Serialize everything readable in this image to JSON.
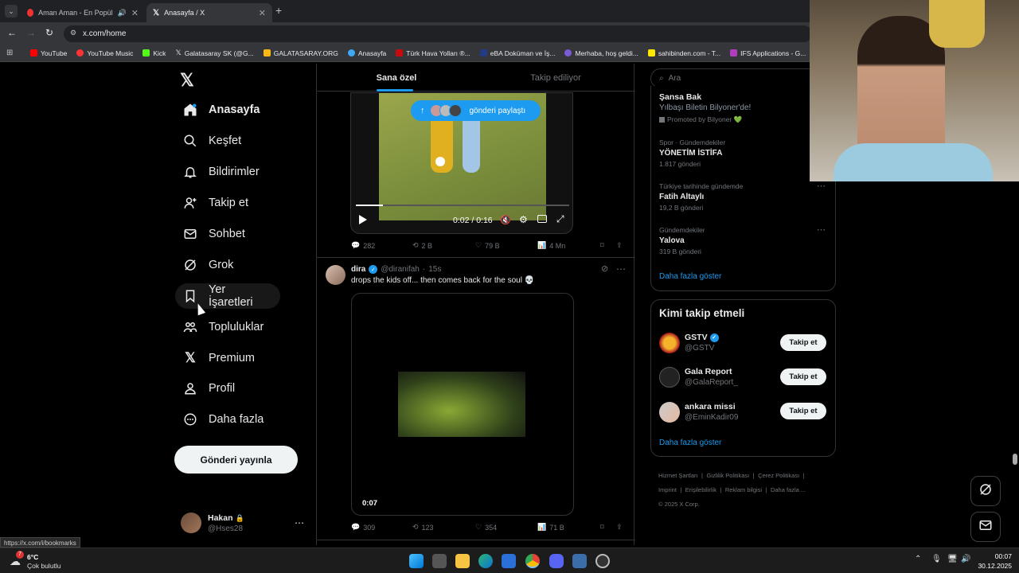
{
  "browser": {
    "tabs": [
      {
        "title": "Aman Aman - En Popüler T..."
      },
      {
        "title": "Anasayfa / X"
      }
    ],
    "url": "x.com/home",
    "bookmarks": [
      "YouTube",
      "YouTube Music",
      "Kick",
      "Galatasaray SK (@G...",
      "GALATASARAY.ORG",
      "Anasayfa",
      "Türk Hava Yolları ®...",
      "eBA Doküman ve İş...",
      "Merhaba, hoş geldi...",
      "sahibinden.com - T...",
      "IFS Applications - G..."
    ],
    "status_url": "https://x.com/i/bookmarks"
  },
  "nav": {
    "items": [
      {
        "label": "Anasayfa",
        "icon": "home-icon"
      },
      {
        "label": "Keşfet",
        "icon": "search-icon"
      },
      {
        "label": "Bildirimler",
        "icon": "bell-icon"
      },
      {
        "label": "Takip et",
        "icon": "person-plus-icon"
      },
      {
        "label": "Sohbet",
        "icon": "envelope-icon"
      },
      {
        "label": "Grok",
        "icon": "grok-icon"
      },
      {
        "label": "Yer İşaretleri",
        "icon": "bookmark-icon"
      },
      {
        "label": "Topluluklar",
        "icon": "people-icon"
      },
      {
        "label": "Premium",
        "icon": "x-logo-icon"
      },
      {
        "label": "Profil",
        "icon": "person-icon"
      },
      {
        "label": "Daha fazla",
        "icon": "more-circle-icon"
      }
    ],
    "post_button": "Gönderi yayınla",
    "account": {
      "name": "Hakan",
      "handle": "@Hses28"
    }
  },
  "feed": {
    "tabs": [
      "Sana özel",
      "Takip ediliyor"
    ],
    "new_posts_pill": "gönderi paylaştı",
    "post1": {
      "video_time": "0:02 / 0:16",
      "replies": "282",
      "reposts": "2 B",
      "likes": "79 B",
      "views": "4 Mn"
    },
    "post2": {
      "name": "dira",
      "handle": "@diranifah",
      "time": "15s",
      "text": "drops the kids off... then comes back for the soul 💀",
      "video_time": "0:07",
      "replies": "309",
      "reposts": "123",
      "likes": "354",
      "views": "71 B"
    }
  },
  "sidebar": {
    "search_placeholder": "Ara",
    "promo": {
      "title": "Şansa Bak",
      "subtitle": "Yılbaşı Biletin Bilyoner'de!",
      "promoted": "Promoted by Bilyoner 💚"
    },
    "trends": [
      {
        "category": "Spor · Gündemdekiler",
        "title": "YÖNETİM İSTİFA",
        "count": "1.817 gönderi"
      },
      {
        "category": "Türkiye tarihinde gündemde",
        "title": "Fatih Altaylı",
        "count": "19,2 B gönderi"
      },
      {
        "category": "Gündemdekiler",
        "title": "Yalova",
        "count": "319 B gönderi"
      }
    ],
    "show_more": "Daha fazla göster",
    "who_to_follow": {
      "title": "Kimi takip etmeli",
      "accounts": [
        {
          "name": "GSTV",
          "handle": "@GSTV",
          "button": "Takip et"
        },
        {
          "name": "Gala Report",
          "handle": "@GalaReport_",
          "button": "Takip et"
        },
        {
          "name": "ankara missi",
          "handle": "@EminKadir09",
          "button": "Takip et"
        }
      ],
      "show_more": "Daha fazla göster"
    },
    "footer": [
      "Hizmet Şartları",
      "Gizlilik Politikası",
      "Çerez Politikası",
      "Imprint",
      "Erişilebilirlik",
      "Reklam bilgisi",
      "Daha fazla ...",
      "© 2025 X Corp."
    ]
  },
  "taskbar": {
    "weather_temp": "6°C",
    "weather_desc": "Çok bulutlu",
    "weather_badge": "7",
    "time": "00:07",
    "date": "30.12.2025"
  }
}
